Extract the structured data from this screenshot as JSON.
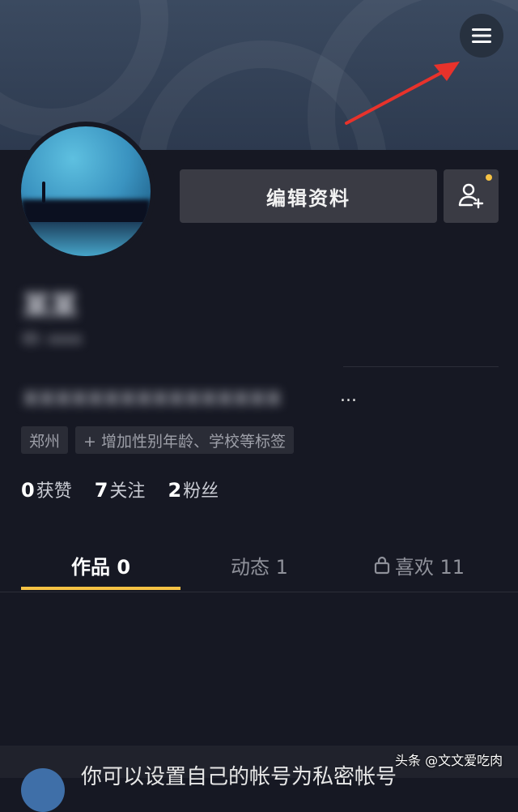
{
  "header": {
    "menu_icon": "hamburger-menu-icon"
  },
  "profile": {
    "edit_label": "编辑资料",
    "add_friend_icon": "add-friend-icon",
    "name_blurred": "某某",
    "id_blurred": "ID: xxxx",
    "bio_blurred": "某某某某某某某某某某某某某某某某",
    "bio_ellipsis": "...",
    "tags": [
      "郑州",
      "+ 增加性别年龄、学校等标签"
    ]
  },
  "stats": [
    {
      "value": "0",
      "label": "获赞"
    },
    {
      "value": "7",
      "label": "关注"
    },
    {
      "value": "2",
      "label": "粉丝"
    }
  ],
  "tabs": [
    {
      "label": "作品 0"
    },
    {
      "label": "动态 1"
    },
    {
      "label": "喜欢 11"
    }
  ],
  "notice": {
    "text": "你可以设置自己的帐号为私密帐号"
  },
  "watermark": "头条 @文文爱吃肉",
  "colors": {
    "background": "#161823",
    "accent": "#f6c244",
    "arrow": "#e8322b"
  }
}
